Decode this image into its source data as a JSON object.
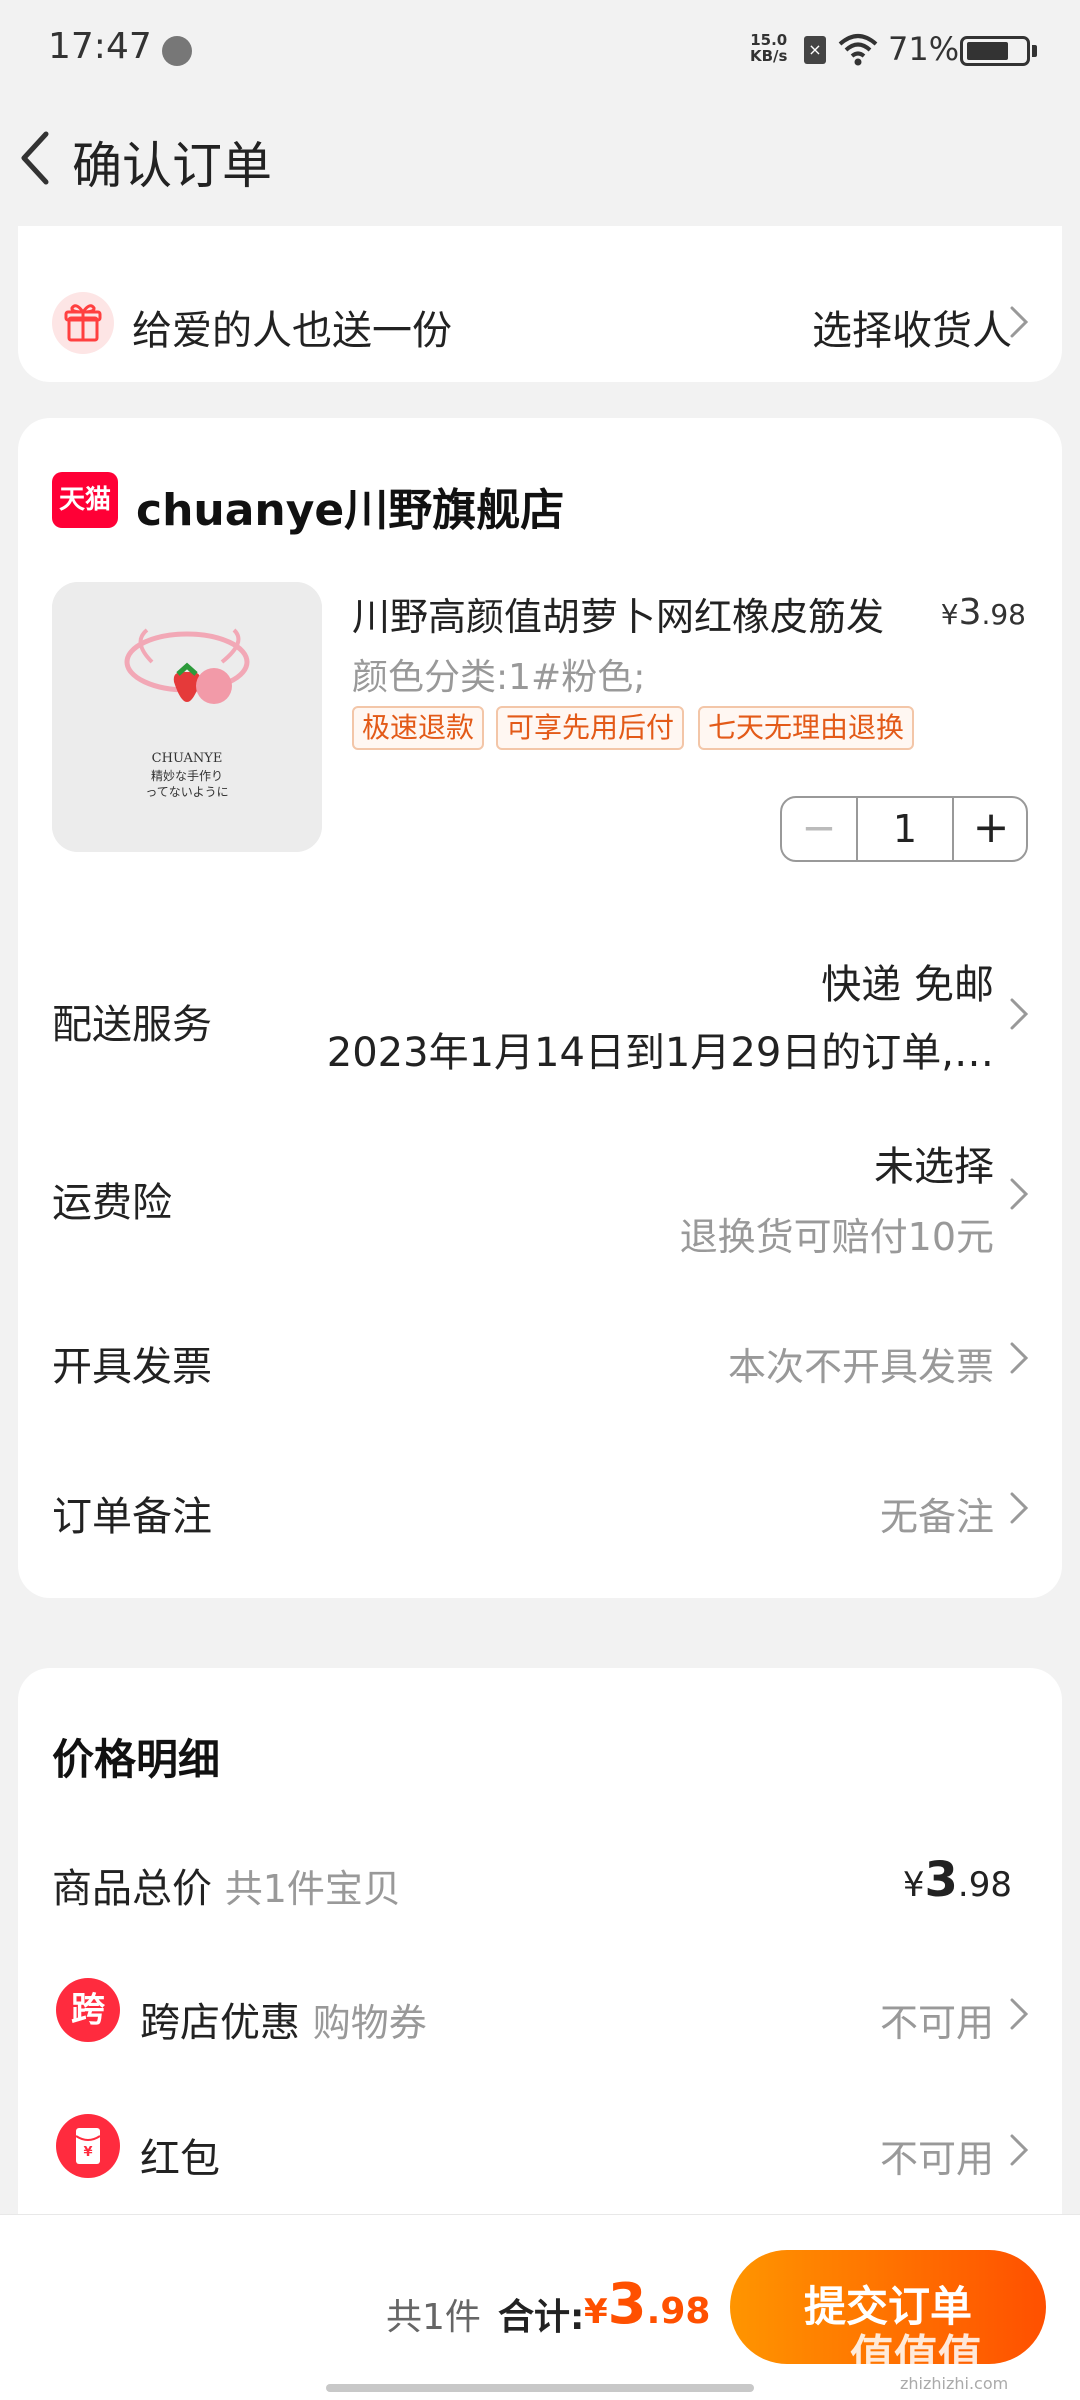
{
  "status_bar": {
    "time": "17:47",
    "net_speed_value": "15.0",
    "net_speed_unit": "KB/s",
    "battery_pct": "71%",
    "battery_level": 0.71
  },
  "header": {
    "title": "确认订单",
    "back_icon": "chevron-left-icon"
  },
  "gift": {
    "text": "给爱的人也送一份",
    "action": "选择收货人",
    "icon": "gift-icon"
  },
  "shop": {
    "badge": "天猫",
    "name": "chuanye川野旗舰店"
  },
  "product": {
    "name": "川野高颜值胡萝卜网红橡皮筋发",
    "price_currency": "¥",
    "price_int": "3",
    "price_dec": ".98",
    "sku": "颜色分类:1#粉色;",
    "tags": [
      "极速退款",
      "可享先用后付",
      "七天无理由退换"
    ],
    "image_caption_1": "CHUANYE",
    "image_caption_2": "精妙な手作り",
    "image_caption_3": "ってないように",
    "quantity": "1",
    "minus": "−",
    "plus": "+"
  },
  "rows": {
    "delivery": {
      "label": "配送服务",
      "main": "快递 免邮",
      "sub": "2023年1月14日到1月29日的订单,…"
    },
    "freight_insurance": {
      "label": "运费险",
      "main": "未选择",
      "sub": "退换货可赔付10元"
    },
    "invoice": {
      "label": "开具发票",
      "value": "本次不开具发票"
    },
    "remark": {
      "label": "订单备注",
      "value": "无备注"
    }
  },
  "price_detail": {
    "title": "价格明细",
    "goods_total_label": "商品总价",
    "goods_total_note": "共1件宝贝",
    "goods_total_currency": "¥",
    "goods_total_int": "3",
    "goods_total_dec": ".98",
    "cross_store": {
      "icon_text": "跨",
      "label": "跨店优惠",
      "note": "购物券",
      "value": "不可用"
    },
    "red_packet": {
      "icon_text": "¥",
      "label": "红包",
      "value": "不可用"
    }
  },
  "bottom_bar": {
    "count": "共1件",
    "total_label": "合计:",
    "total_currency": "¥",
    "total_int": "3",
    "total_dec": ".98",
    "submit": "提交订单",
    "watermark": "值值值",
    "watermark_url": "zhizhizhi.com"
  },
  "colors": {
    "accent": "#ff5000",
    "tmall_red": "#ff0036",
    "background": "#f2f2f2"
  }
}
